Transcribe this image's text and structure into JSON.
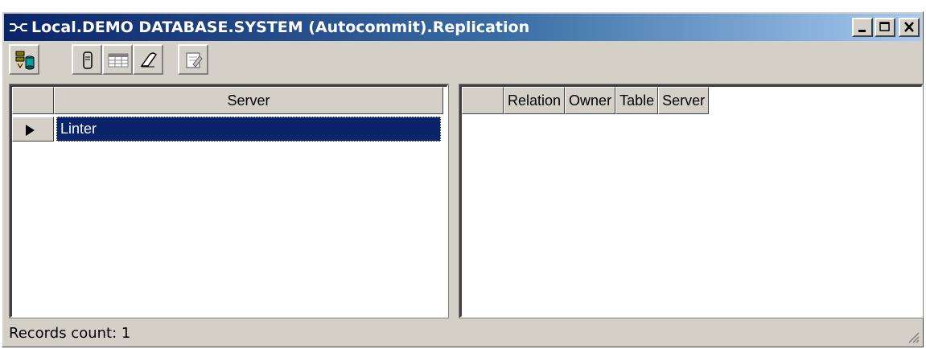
{
  "window": {
    "title": "Local.DEMO DATABASE.SYSTEM (Autocommit).Replication",
    "title_icon": "replication-link-icon",
    "controls": [
      "minimize",
      "maximize",
      "close"
    ]
  },
  "toolbar": {
    "buttons": [
      {
        "icon": "add-server-icon"
      },
      {
        "icon": "database-icon"
      },
      {
        "icon": "table-icon"
      },
      {
        "icon": "eraser-icon"
      },
      {
        "icon": "properties-icon"
      }
    ]
  },
  "servers_grid": {
    "columns": [
      "Server"
    ],
    "rows": [
      {
        "server": "Linter",
        "selected": true
      }
    ]
  },
  "relations_grid": {
    "columns": [
      "Relation",
      "Owner",
      "Table",
      "Server"
    ],
    "rows": []
  },
  "status": {
    "records_count": "Records count: 1"
  },
  "colors": {
    "title_gradient_start": "#0a246a",
    "title_gradient_end": "#a6caf0",
    "selection": "#0a246a",
    "face": "#d4d0c8"
  }
}
